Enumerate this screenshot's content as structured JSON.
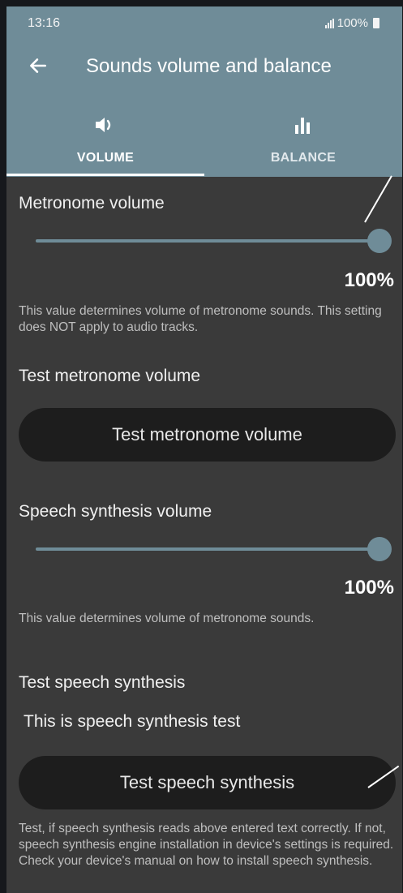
{
  "status_bar": {
    "time": "13:16",
    "battery": "100%"
  },
  "app_bar": {
    "title": "Sounds volume and balance"
  },
  "tabs": [
    {
      "label": "VOLUME",
      "icon": "speaker-icon",
      "selected": true
    },
    {
      "label": "BALANCE",
      "icon": "bar-chart-icon",
      "selected": false
    }
  ],
  "metronome": {
    "label": "Metronome volume",
    "value": "100%",
    "level": 1.0,
    "description": "This value determines volume of metronome sounds. This setting does NOT apply to audio tracks."
  },
  "test_metronome": {
    "label": "Test metronome volume",
    "button": "Test metronome volume"
  },
  "speech": {
    "label": "Speech synthesis volume",
    "value": "100%",
    "level": 1.0,
    "description": "This value determines volume of metronome sounds."
  },
  "test_speech": {
    "label": "Test speech synthesis",
    "input_value": "This is speech synthesis test",
    "button": "Test speech synthesis",
    "description": "Test, if speech synthesis reads above entered text correctly. If not, speech synthesis engine installation in device's settings is required. Check your device's manual on how to install speech synthesis."
  },
  "colors": {
    "accent": "#6f8c98",
    "background": "#3a3a3a",
    "button": "#1d1d1d"
  }
}
